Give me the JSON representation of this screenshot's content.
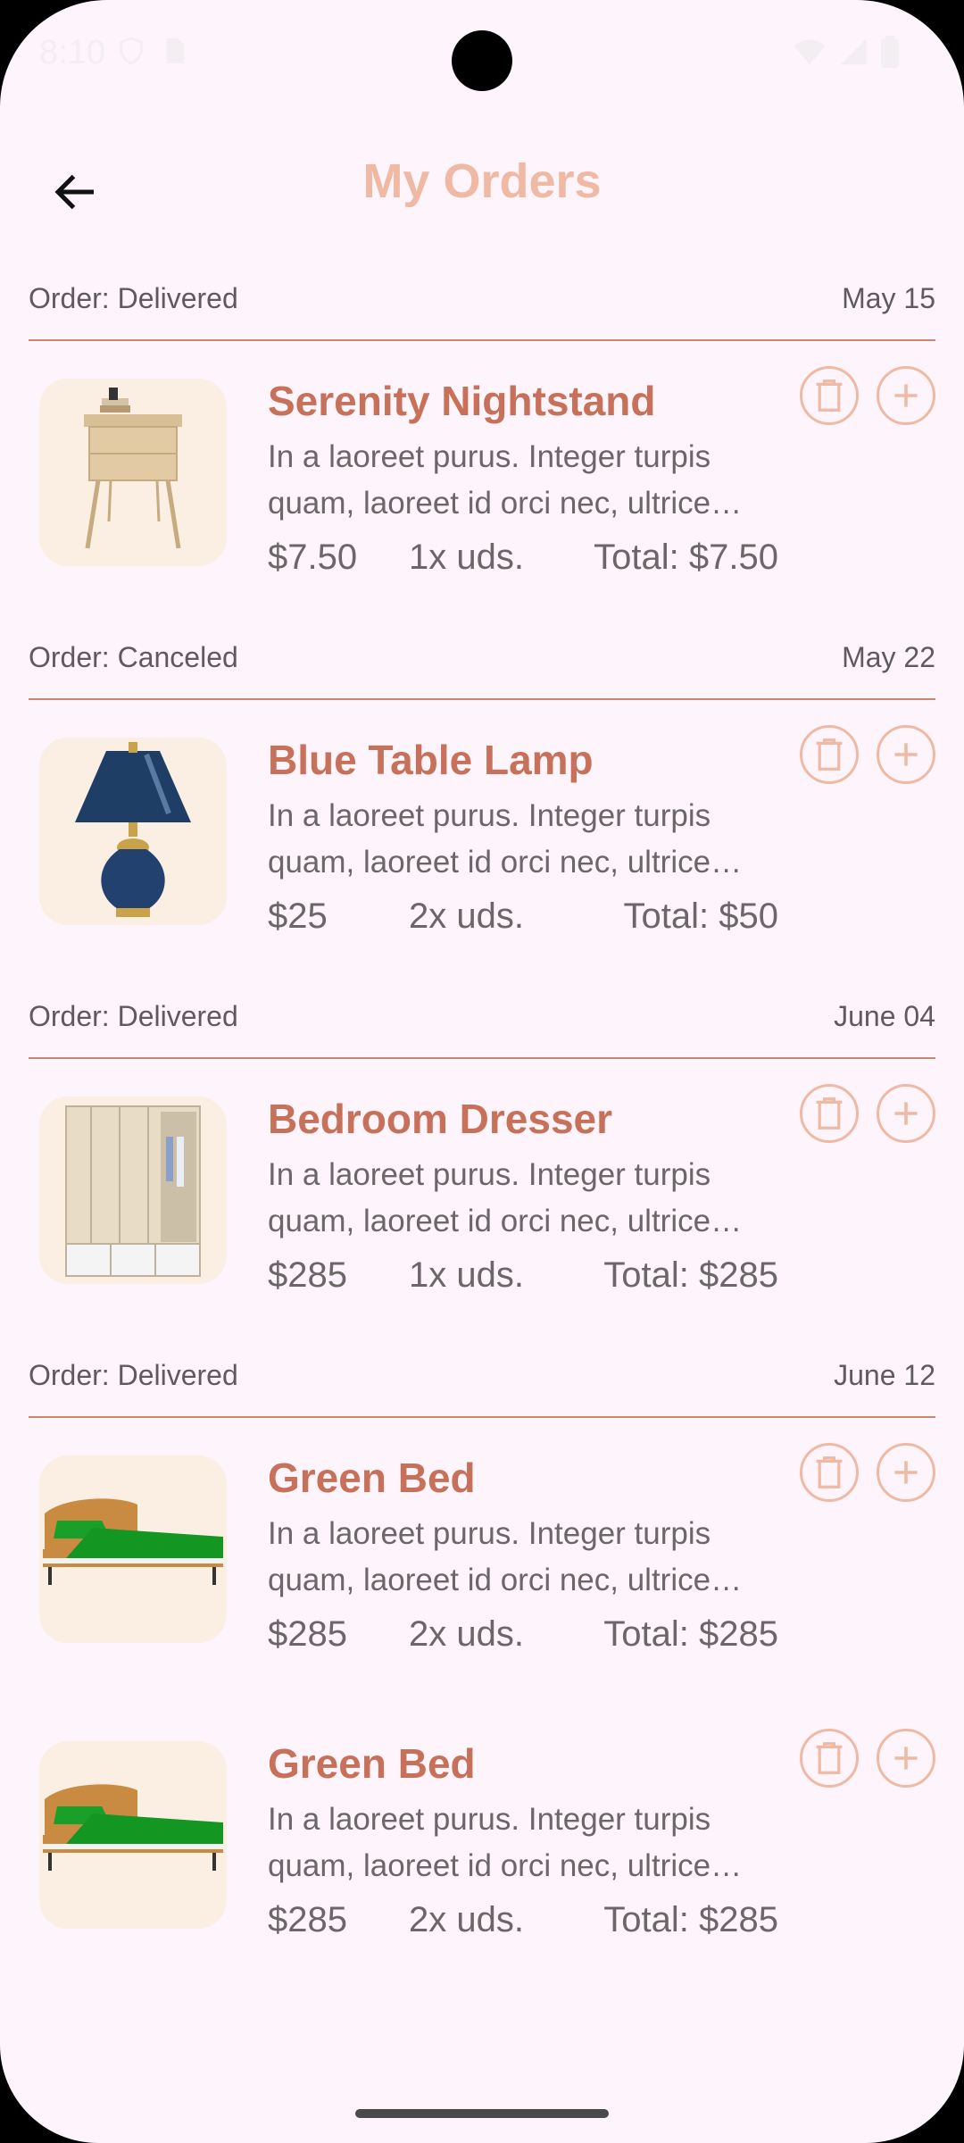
{
  "status_bar": {
    "time": "8:10"
  },
  "app_bar": {
    "title": "My Orders"
  },
  "orders": [
    {
      "status": "Order: Delivered",
      "date": "May 15",
      "items": [
        {
          "name": "Serenity Nightstand",
          "desc_line1": "In a laoreet purus. Integer turpis",
          "desc_line2": "quam, laoreet id orci nec, ultrice…",
          "price": "$7.50",
          "qty": "1x uds.",
          "total": "Total: $7.50",
          "image": "nightstand"
        }
      ]
    },
    {
      "status": "Order: Canceled",
      "date": "May 22",
      "items": [
        {
          "name": "Blue Table Lamp",
          "desc_line1": "In a laoreet purus. Integer turpis",
          "desc_line2": "quam, laoreet id orci nec, ultrice…",
          "price": "$25",
          "qty": "2x uds.",
          "total": "Total: $50",
          "image": "table-lamp"
        }
      ]
    },
    {
      "status": "Order: Delivered",
      "date": "June 04",
      "items": [
        {
          "name": "Bedroom Dresser",
          "desc_line1": "In a laoreet purus. Integer turpis",
          "desc_line2": "quam, laoreet id orci nec, ultrice…",
          "price": "$285",
          "qty": "1x uds.",
          "total": "Total: $285",
          "image": "wardrobe"
        }
      ]
    },
    {
      "status": "Order: Delivered",
      "date": "June 12",
      "items": [
        {
          "name": "Green Bed",
          "desc_line1": "In a laoreet purus. Integer turpis",
          "desc_line2": "quam, laoreet id orci nec, ultrice…",
          "price": "$285",
          "qty": "2x uds.",
          "total": "Total: $285",
          "image": "green-bed"
        },
        {
          "name": "Green Bed",
          "desc_line1": "In a laoreet purus. Integer turpis",
          "desc_line2": "quam, laoreet id orci nec, ultrice…",
          "price": "$285",
          "qty": "2x uds.",
          "total": "Total: $285",
          "image": "green-bed"
        }
      ]
    }
  ],
  "icons": {
    "back": "arrow-left-icon",
    "delete": "trash-icon",
    "add": "plus-circle-icon"
  },
  "colors": {
    "accent": "#c7705a",
    "accent_light": "#f0b9a3",
    "background": "#fdf5fb",
    "thumb_bg": "#fbefe4",
    "divider": "#c98772"
  }
}
